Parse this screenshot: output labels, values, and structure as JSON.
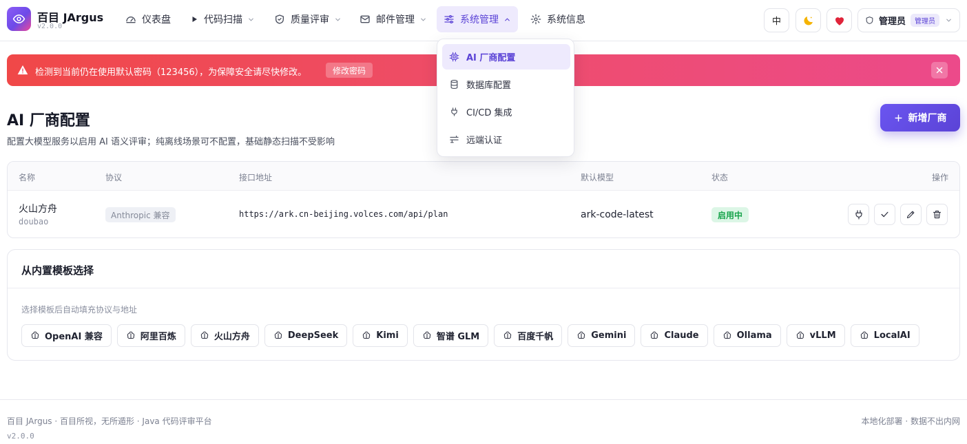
{
  "brand": {
    "name": "百目 JArgus",
    "version": "v2.0.0"
  },
  "nav": [
    {
      "label": "仪表盘",
      "icon": "gauge-icon",
      "has_menu": false
    },
    {
      "label": "代码扫描",
      "icon": "play-icon",
      "has_menu": true
    },
    {
      "label": "质量评审",
      "icon": "shield-icon",
      "has_menu": true
    },
    {
      "label": "邮件管理",
      "icon": "mail-icon",
      "has_menu": true
    },
    {
      "label": "系统管理",
      "icon": "sliders-icon",
      "has_menu": true,
      "active": true
    },
    {
      "label": "系统信息",
      "icon": "gear-icon",
      "has_menu": false
    }
  ],
  "toolbar": {
    "lang_label": "中",
    "theme_icon": "moon-icon",
    "favorite_icon": "heart-icon",
    "user_name": "管理员",
    "user_role": "管理员"
  },
  "dropdown": {
    "items": [
      {
        "label": "AI 厂商配置",
        "icon": "cpu-icon",
        "active": true
      },
      {
        "label": "数据库配置",
        "icon": "database-icon",
        "active": false
      },
      {
        "label": "CI/CD 集成",
        "icon": "plug-icon",
        "active": false
      },
      {
        "label": "远端认证",
        "icon": "server-icon",
        "active": false
      }
    ]
  },
  "alert": {
    "text": "检测到当前仍在使用默认密码（123456），为保障安全请尽快修改。",
    "button": "修改密码"
  },
  "page": {
    "title": "AI 厂商配置",
    "subtitle": "配置大模型服务以启用 AI 语义评审；纯离线场景可不配置，基础静态扫描不受影响",
    "add_button": "新增厂商"
  },
  "table": {
    "columns": [
      "名称",
      "协议",
      "接口地址",
      "默认模型",
      "状态",
      "操作"
    ],
    "rows": [
      {
        "name": "火山方舟",
        "code": "doubao",
        "protocol": "Anthropic 兼容",
        "url": "https://ark.cn-beijing.volces.com/api/plan",
        "model": "ark-code-latest",
        "status": "启用中"
      }
    ]
  },
  "templates": {
    "title": "从内置模板选择",
    "hint": "选择模板后自动填充协议与地址",
    "items": [
      "OpenAI 兼容",
      "阿里百炼",
      "火山方舟",
      "DeepSeek",
      "Kimi",
      "智谱 GLM",
      "百度千帆",
      "Gemini",
      "Claude",
      "Ollama",
      "vLLM",
      "LocalAI"
    ]
  },
  "footer": {
    "left": "百目 JArgus · 百目所视，无所遁形 · Java 代码评审平台",
    "version": "v2.0.0",
    "right": "本地化部署 · 数据不出内网"
  },
  "colors": {
    "accent": "#5b43d6",
    "alert_start": "#f04848",
    "alert_end": "#ec4a8a",
    "success": "#16a34a"
  }
}
